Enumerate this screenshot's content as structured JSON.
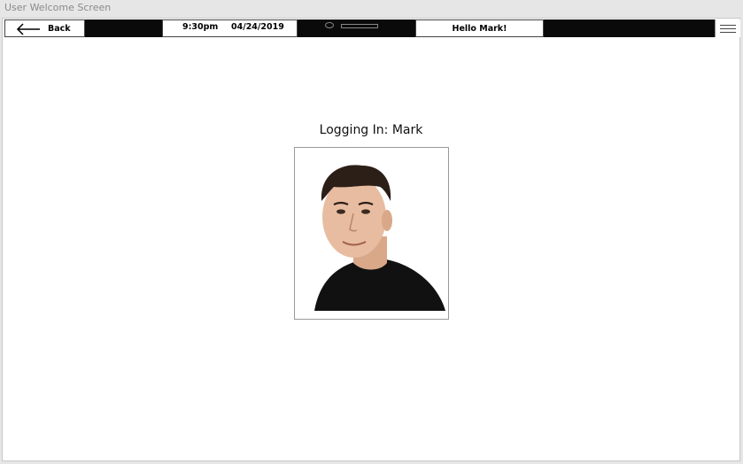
{
  "window": {
    "title": "User Welcome Screen"
  },
  "topbar": {
    "back_label": "Back",
    "time": "9:30pm",
    "date": "04/24/2019",
    "greeting": "Hello Mark!"
  },
  "main": {
    "login_title": "Logging In: Mark"
  },
  "icons": {
    "back": "left-arrow-icon",
    "menu": "hamburger-menu-icon"
  },
  "colors": {
    "topbar_bg": "#0a0a0a",
    "content_bg": "#ffffff"
  }
}
